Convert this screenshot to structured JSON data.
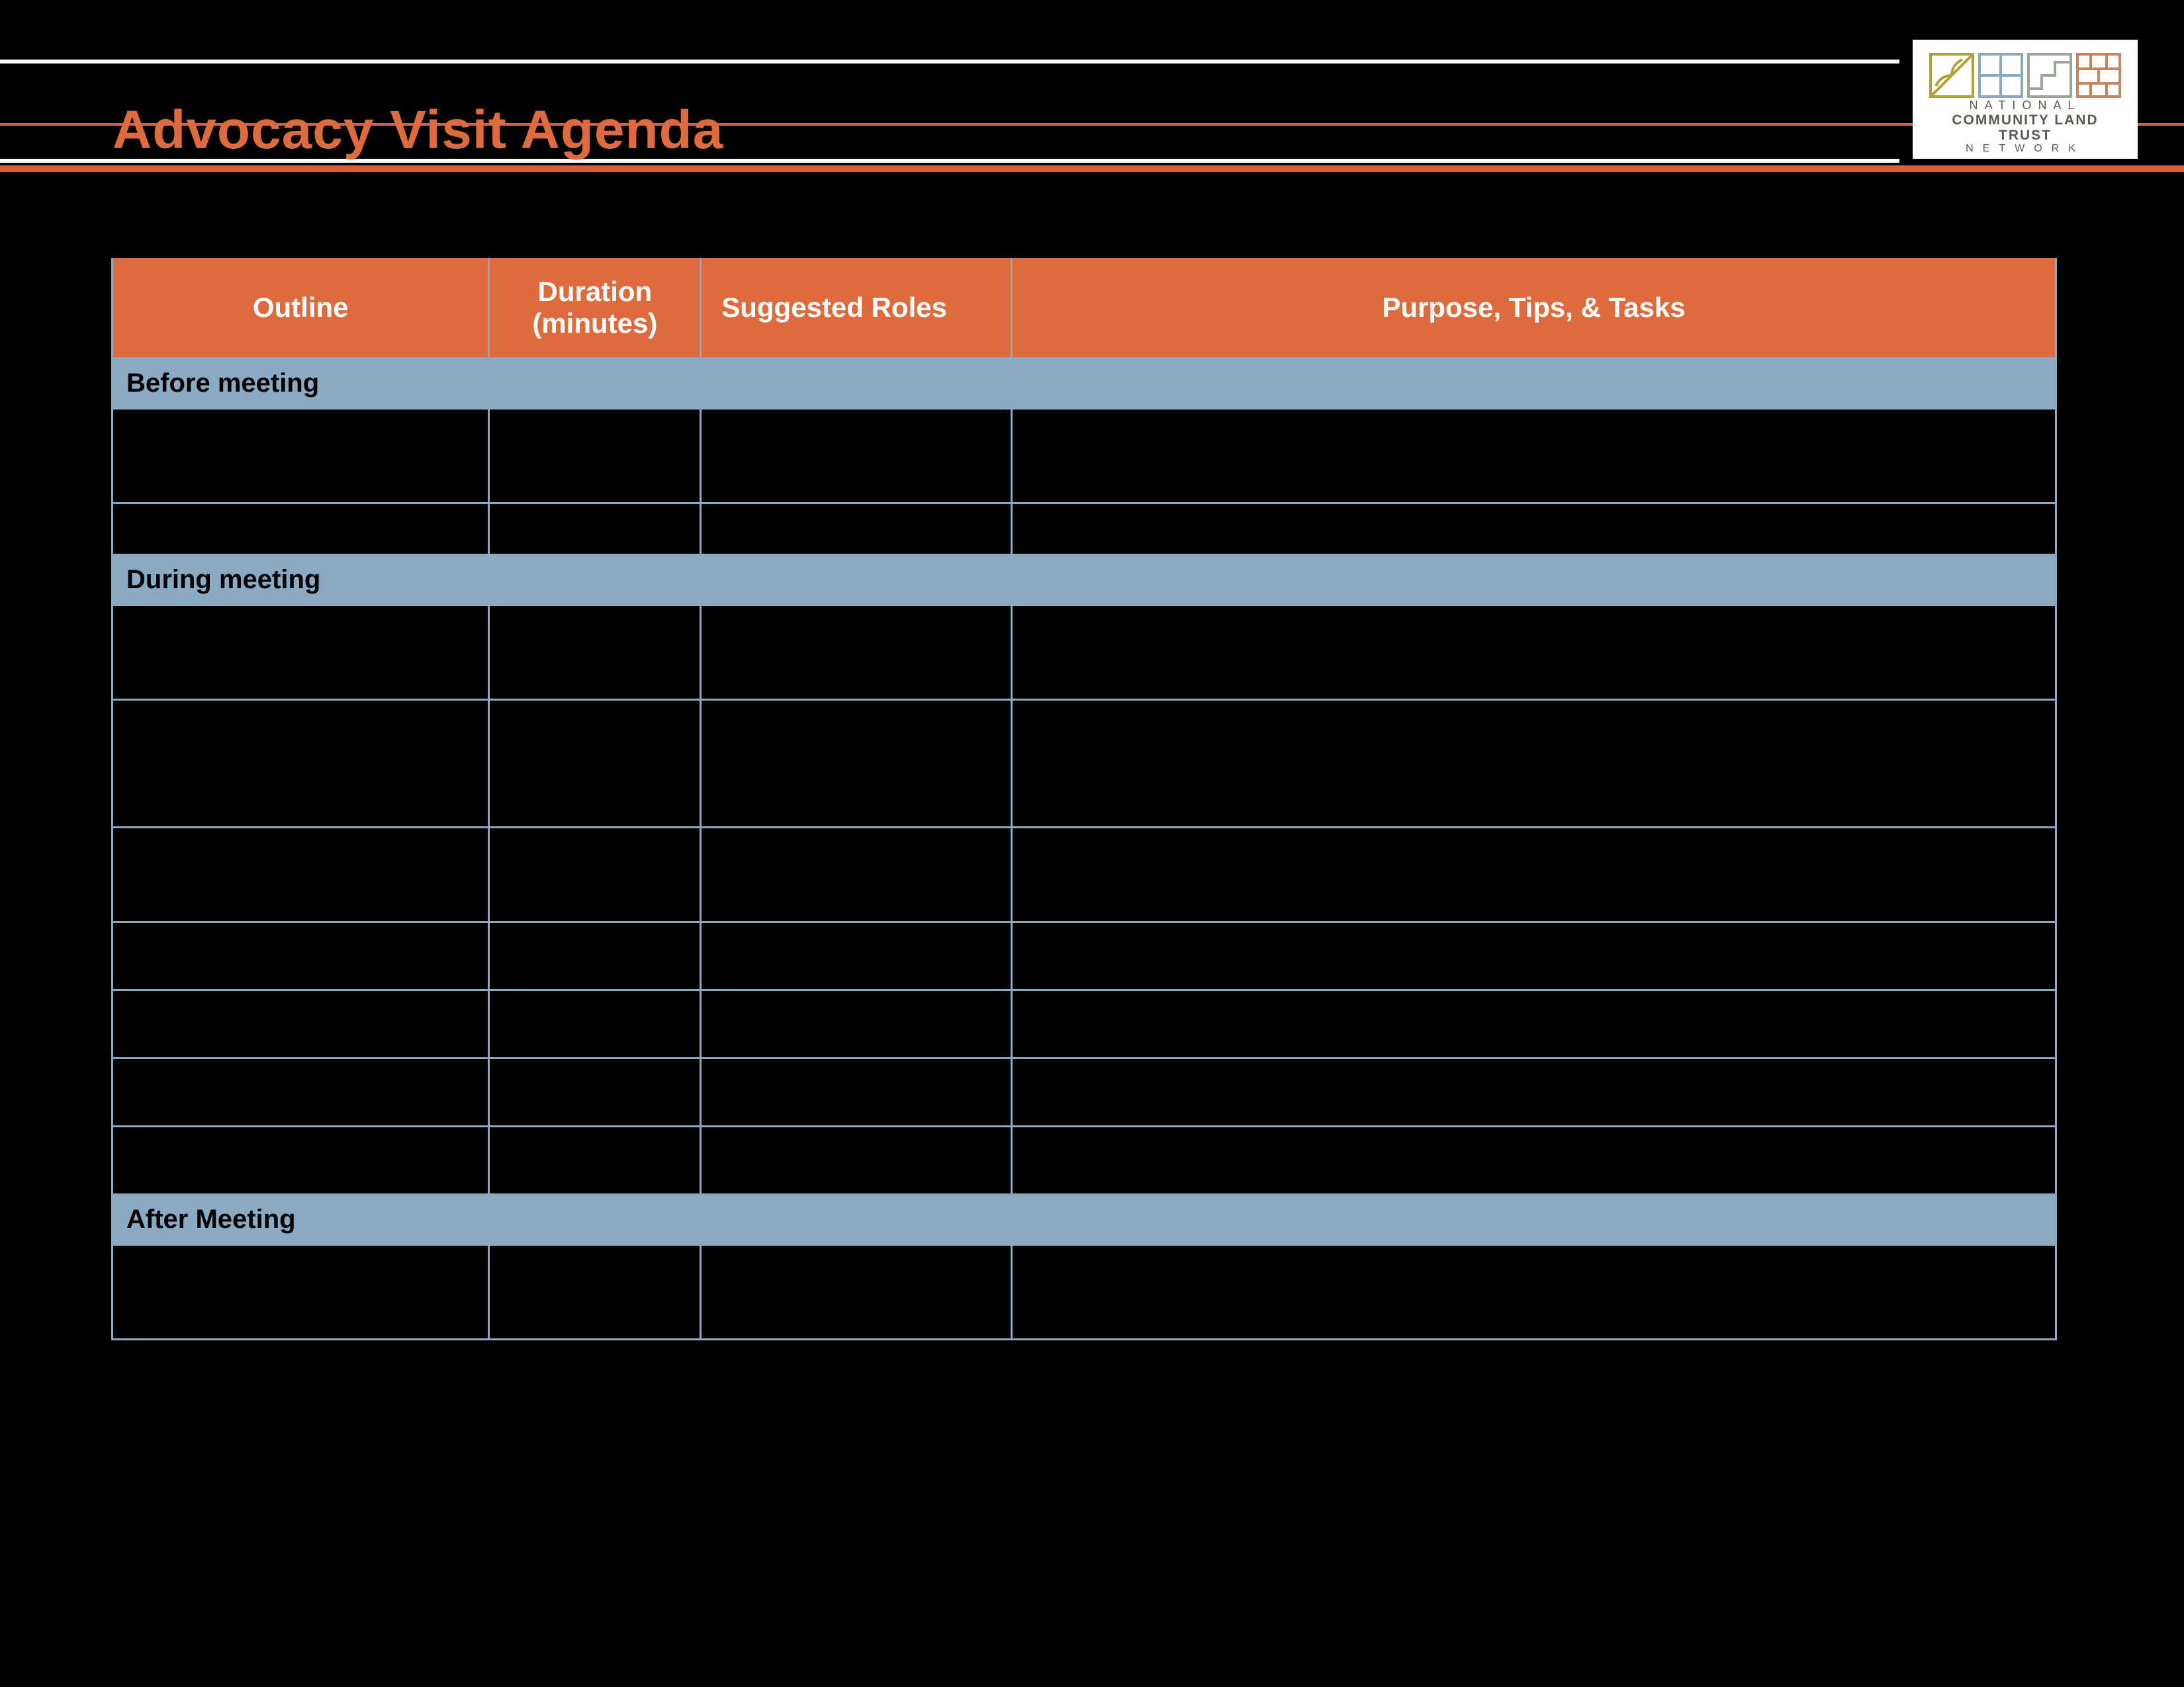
{
  "page": {
    "title": "Advocacy Visit Agenda"
  },
  "logo": {
    "line1": "NATIONAL",
    "line2": "COMMUNITY LAND TRUST",
    "line3": "NETWORK"
  },
  "table": {
    "headers": {
      "outline": "Outline",
      "duration_line1": "Duration",
      "duration_line2": "(minutes)",
      "roles": "Suggested Roles",
      "purpose": "Purpose, Tips,  & Tasks"
    },
    "sections": [
      {
        "label": "Before meeting",
        "rows": [
          {
            "h": "h-tall",
            "outline": "",
            "duration": "",
            "roles": "",
            "purpose": ""
          },
          {
            "h": "h-short",
            "outline": "",
            "duration": "",
            "roles": "",
            "purpose": ""
          }
        ]
      },
      {
        "label": "During meeting",
        "rows": [
          {
            "h": "h-tall",
            "outline": "",
            "duration": "",
            "roles": "",
            "purpose": ""
          },
          {
            "h": "h-big",
            "outline": "",
            "duration": "",
            "roles": "",
            "purpose": ""
          },
          {
            "h": "h-tall",
            "outline": "",
            "duration": "",
            "roles": "",
            "purpose": ""
          },
          {
            "h": "h-med",
            "outline": "",
            "duration": "",
            "roles": "",
            "purpose": ""
          },
          {
            "h": "h-med",
            "outline": "",
            "duration": "",
            "roles": "",
            "purpose": ""
          },
          {
            "h": "h-med",
            "outline": "",
            "duration": "",
            "roles": "",
            "purpose": ""
          },
          {
            "h": "h-med",
            "outline": "",
            "duration": "",
            "roles": "",
            "purpose": ""
          }
        ]
      },
      {
        "label": "After Meeting",
        "rows": [
          {
            "h": "h-tall",
            "outline": "",
            "duration": "",
            "roles": "",
            "purpose": ""
          }
        ]
      }
    ]
  }
}
